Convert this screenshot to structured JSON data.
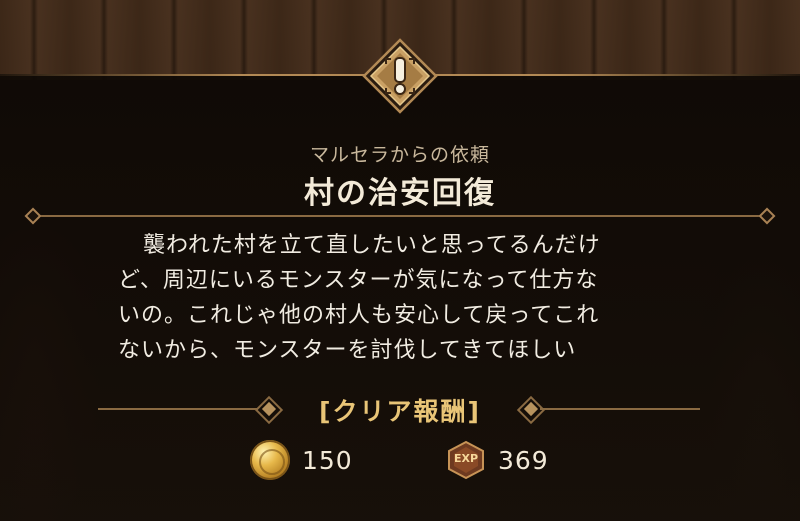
{
  "quest": {
    "requester": "マルセラからの依頼",
    "title": "村の治安回復",
    "description_lines": [
      "襲われた村を立て直したいと思ってるんだけ",
      "ど、周辺にいるモンスターが気になって仕方な",
      "いの。これじゃ他の村人も安心して戻ってこれ",
      "ないから、モンスターを討伐してきてほしい"
    ],
    "icon": "exclamation-icon"
  },
  "reward": {
    "header": "[クリア報酬]",
    "gold": {
      "icon": "gold-coin-icon",
      "value": "150"
    },
    "exp": {
      "icon": "exp-icon",
      "label": "EXP",
      "value": "369"
    }
  },
  "colors": {
    "accent_gold": "#e9c577",
    "frame_bronze": "#b38a55",
    "text_main": "#f1ece2",
    "text_sub": "#c9b89c",
    "panel_bg": "#120c07"
  }
}
